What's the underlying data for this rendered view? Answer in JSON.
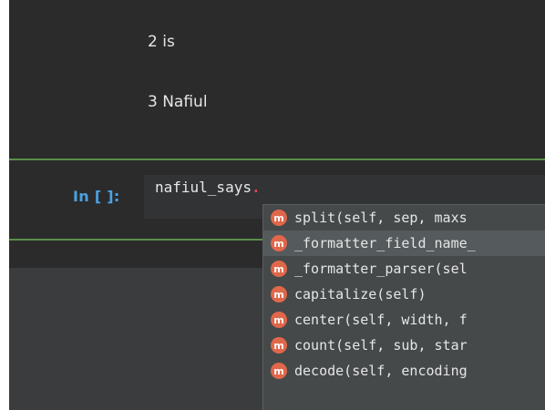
{
  "output_lines": [
    {
      "text": "2 is"
    },
    {
      "text": "3 Nafiul"
    }
  ],
  "cell": {
    "prompt": "In [ ]:",
    "code": "nafiul_says",
    "cursor_char": "."
  },
  "completion_popup": {
    "icon_letter": "m",
    "items": [
      {
        "label": "split(self, sep, maxs"
      },
      {
        "label": "_formatter_field_name_"
      },
      {
        "label": "_formatter_parser(sel"
      },
      {
        "label": "capitalize(self)"
      },
      {
        "label": "center(self, width, f"
      },
      {
        "label": "count(self, sub, star"
      },
      {
        "label": "decode(self, encoding"
      }
    ]
  },
  "colors": {
    "background": "#2b2b2b",
    "prompt": "#4aa3e6",
    "separator": "#5a8f4a",
    "cursor": "#e2455a",
    "method_icon": "#e0674a"
  }
}
